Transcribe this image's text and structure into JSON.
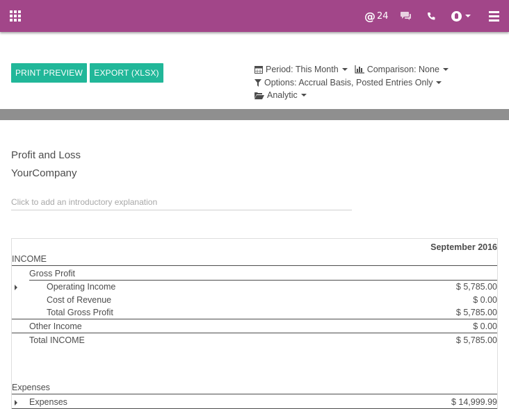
{
  "topbar": {
    "apps_icon": "apps-grid-icon",
    "mention_count": "24",
    "icons": [
      "at-icon",
      "chat-icon",
      "phone-icon",
      "avatar",
      "menu-icon"
    ]
  },
  "toolbar": {
    "print_preview": "PRINT PREVIEW",
    "export_xlsx": "EXPORT (XLSX)"
  },
  "filters": {
    "period": "Period: This Month",
    "comparison": "Comparison: None",
    "options": "Options: Accrual Basis, Posted Entries Only",
    "analytic": "Analytic"
  },
  "report": {
    "title": "Profit and Loss",
    "company": "YourCompany",
    "intro_placeholder": "Click to add an introductory explanation",
    "column": "September 2016",
    "rows": [
      {
        "label": "INCOME",
        "amount": ""
      },
      {
        "label": "Gross Profit",
        "amount": ""
      },
      {
        "label": "Operating Income",
        "amount": "$ 5,785.00"
      },
      {
        "label": "Cost of Revenue",
        "amount": "$ 0.00"
      },
      {
        "label": "Total Gross Profit",
        "amount": "$ 5,785.00"
      },
      {
        "label": "Other Income",
        "amount": "$ 0.00"
      },
      {
        "label": "Total INCOME",
        "amount": "$ 5,785.00"
      },
      {
        "label": "Expenses",
        "amount": ""
      },
      {
        "label": "Expenses",
        "amount": "$ 14,999.99"
      }
    ]
  },
  "colors": {
    "topbar": "#a24689",
    "button": "#21b799",
    "divider": "#8f8f8f"
  }
}
